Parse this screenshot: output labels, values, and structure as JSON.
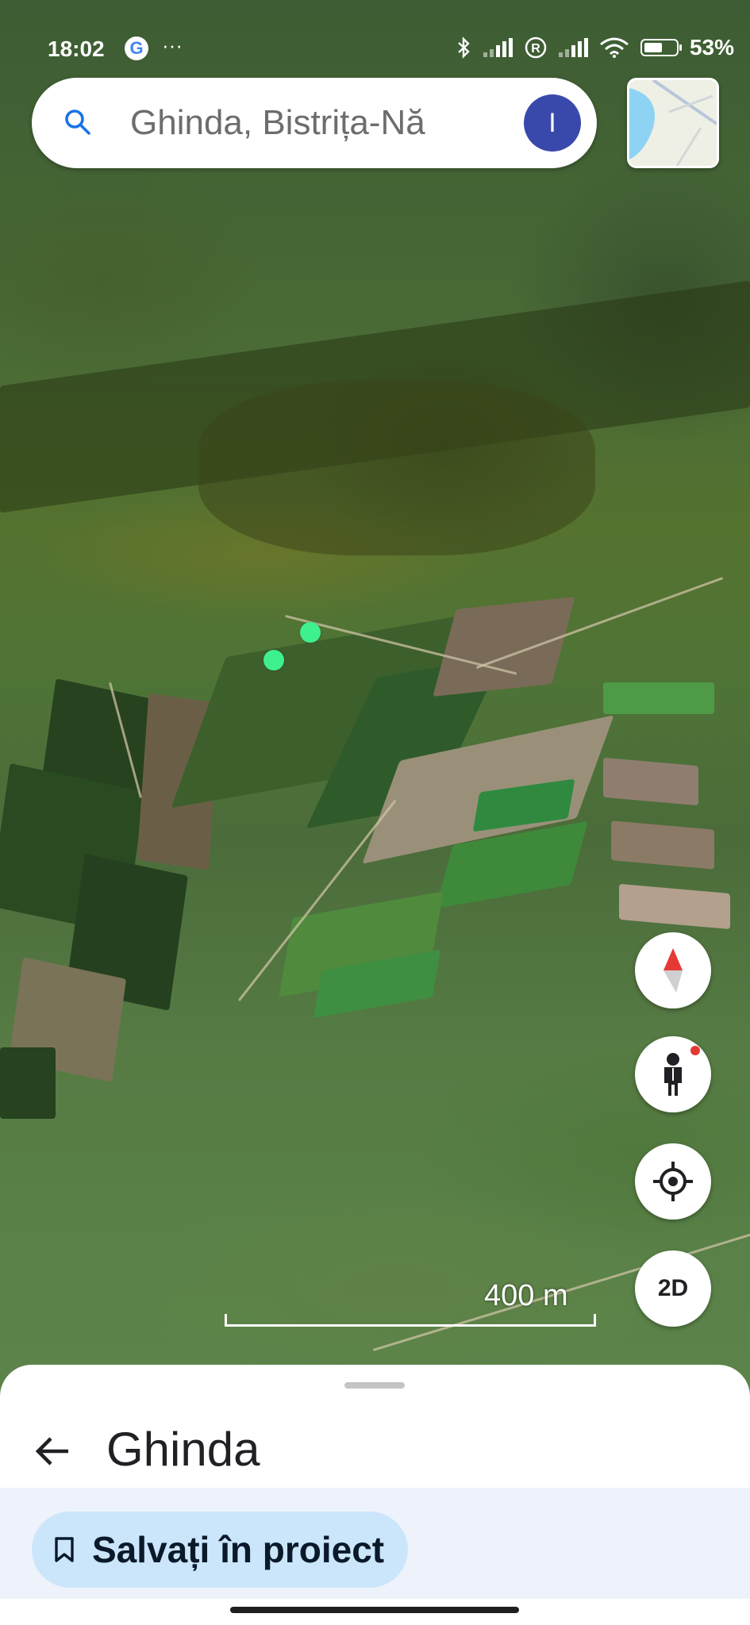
{
  "status_bar": {
    "time": "18:02",
    "google_icon": "G",
    "more_icon": "···",
    "battery_percent": "53%",
    "icons": [
      "bluetooth-icon",
      "signal-icon",
      "roaming-icon",
      "signal-icon",
      "wifi-icon",
      "battery-icon"
    ]
  },
  "search": {
    "query": "Ghinda, Bistrița-Nă",
    "avatar_initial": "I",
    "search_icon": "search-icon"
  },
  "map": {
    "layer_thumbnail": "map-layer-thumbnail",
    "scale_label": "400 m",
    "marker_color": "#3ff08f"
  },
  "controls": {
    "compass": "compass-icon",
    "street_view": "pegman-icon",
    "my_location": "my-location-icon",
    "view_mode": "2D"
  },
  "sheet": {
    "title": "Ghinda",
    "save_label": "Salvați în proiect",
    "accent_color": "#cbe6fb"
  }
}
